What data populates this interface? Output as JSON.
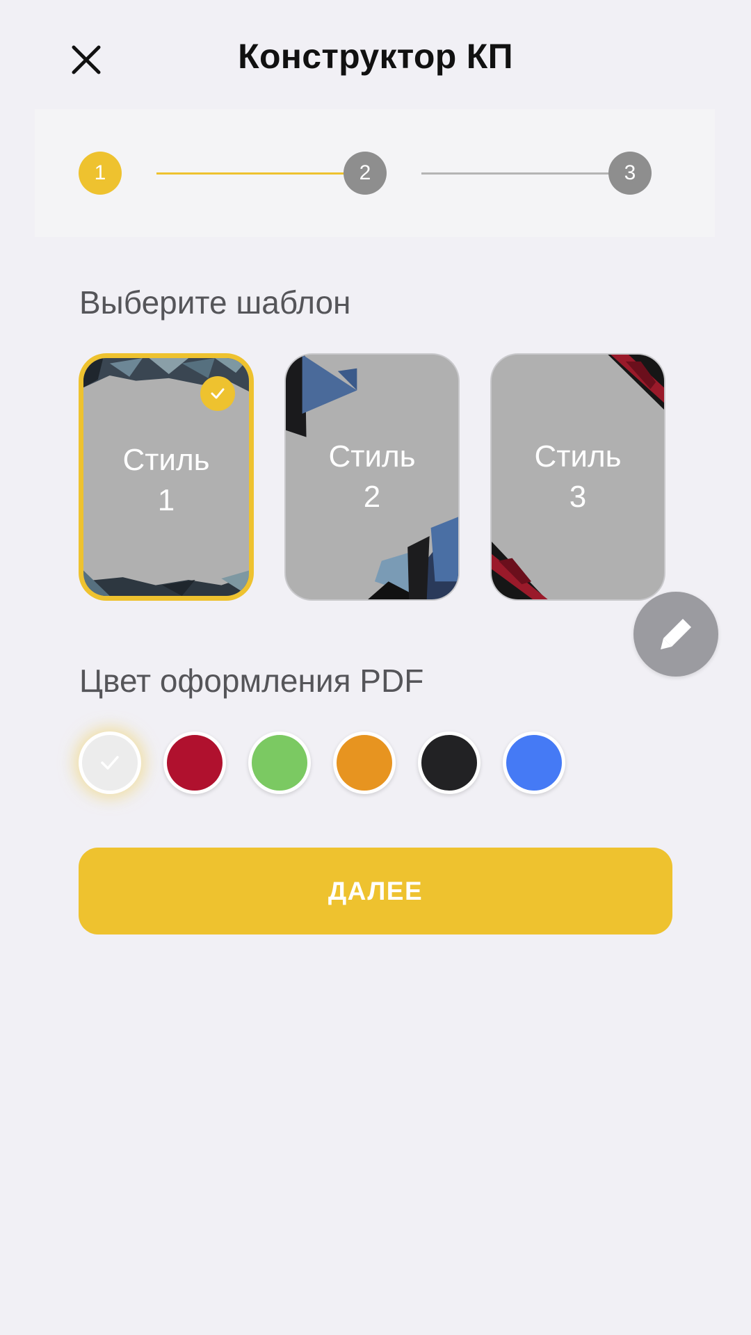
{
  "header": {
    "title": "Конструктор КП"
  },
  "stepper": {
    "steps": [
      "1",
      "2",
      "3"
    ],
    "active_step": 1,
    "active_color": "#eec22f",
    "inactive_color": "#8e8e8e"
  },
  "templates": {
    "title": "Выберите шаблон",
    "items": [
      {
        "line1": "Стиль",
        "line2": "1",
        "selected": true
      },
      {
        "line1": "Стиль",
        "line2": "2",
        "selected": false
      },
      {
        "line1": "Стиль",
        "line2": "3",
        "selected": false
      }
    ]
  },
  "colors": {
    "title": "Цвет оформления PDF",
    "swatches": [
      "#ececec",
      "#b0112e",
      "#7bc962",
      "#e79420",
      "#222224",
      "#457af5"
    ],
    "selected_index": 0
  },
  "actions": {
    "next_label": "ДАЛЕЕ"
  }
}
